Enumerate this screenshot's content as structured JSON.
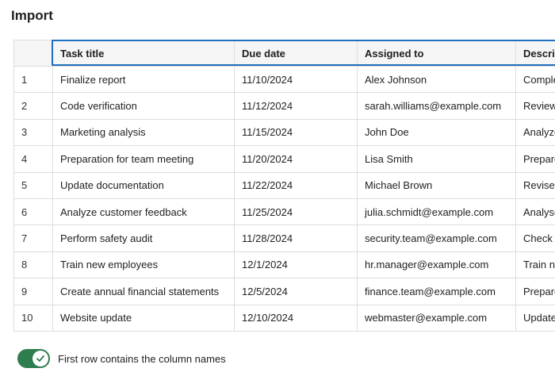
{
  "header": {
    "title": "Import"
  },
  "table": {
    "columns": [
      "",
      "Task title",
      "Due date",
      "Assigned to",
      "Description"
    ],
    "rows": [
      [
        "1",
        "Finalize report",
        "11/10/2024",
        "Alex Johnson",
        "Complete the final report"
      ],
      [
        "2",
        "Code verification",
        "11/12/2024",
        "sarah.williams@example.com",
        "Review the code"
      ],
      [
        "3",
        "Marketing analysis",
        "11/15/2024",
        "John Doe",
        "Analyze marketing data"
      ],
      [
        "4",
        "Preparation for team meeting",
        "11/20/2024",
        "Lisa Smith",
        "Prepare the agenda"
      ],
      [
        "5",
        "Update documentation",
        "11/22/2024",
        "Michael Brown",
        "Revise the documentation"
      ],
      [
        "6",
        "Analyze customer feedback",
        "11/25/2024",
        "julia.schmidt@example.com",
        "Analyse the feedback"
      ],
      [
        "7",
        "Perform safety audit",
        "11/28/2024",
        "security.team@example.com",
        "Check safety measures"
      ],
      [
        "8",
        "Train new employees",
        "12/1/2024",
        "hr.manager@example.com",
        "Train new staff"
      ],
      [
        "9",
        "Create annual financial statements",
        "12/5/2024",
        "finance.team@example.com",
        "Prepare statements"
      ],
      [
        "10",
        "Website update",
        "12/10/2024",
        "webmaster@example.com",
        "Update the website"
      ]
    ]
  },
  "options": {
    "first_row_header_label": "First row contains the column names",
    "first_row_header_on": true
  },
  "colors": {
    "accent": "#2e7d4f",
    "focus": "#1e6fbf"
  },
  "icons": {
    "toggle": "check-icon"
  }
}
